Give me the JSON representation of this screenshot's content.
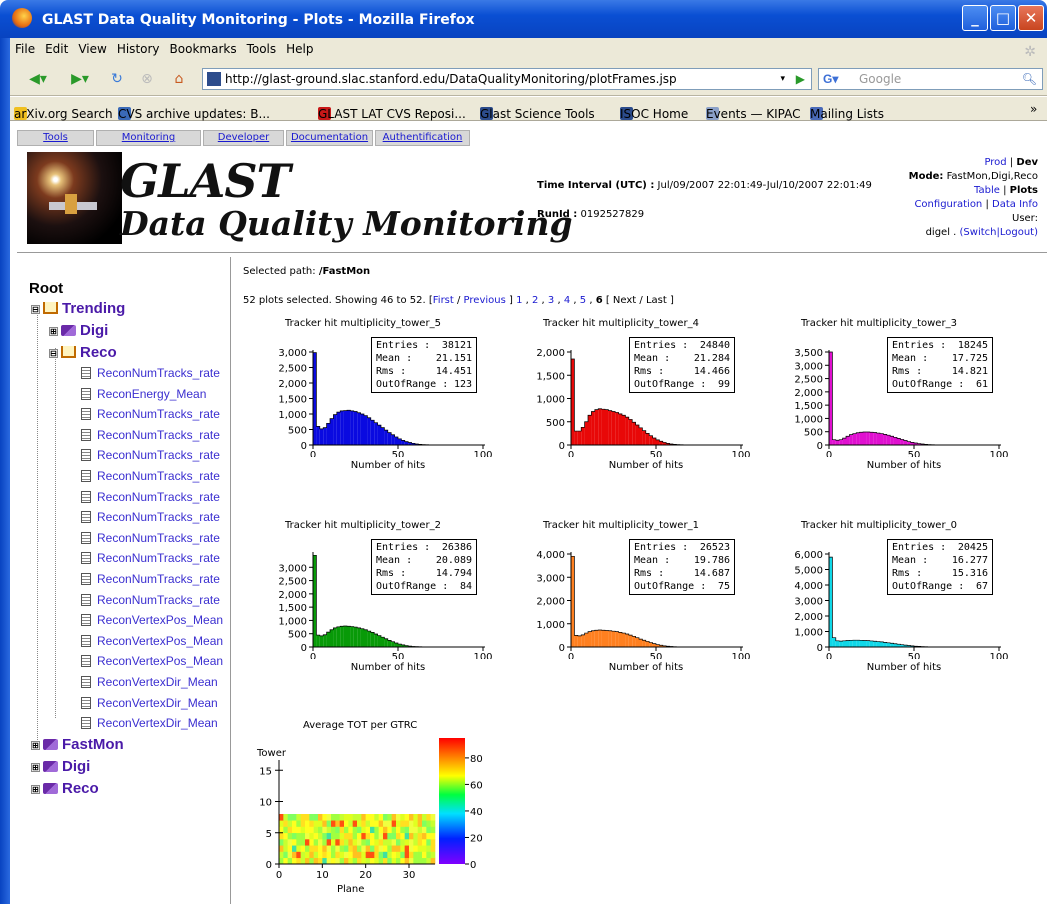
{
  "window": {
    "title": "GLAST Data Quality Monitoring - Plots - Mozilla Firefox"
  },
  "menu": [
    "File",
    "Edit",
    "View",
    "History",
    "Bookmarks",
    "Tools",
    "Help"
  ],
  "url": "http://glast-ground.slac.stanford.edu/DataQualityMonitoring/plotFrames.jsp",
  "search_placeholder": "Google",
  "bookmarks": [
    "arXiv.org Search",
    "CVS archive updates: B...",
    "GLAST LAT CVS Reposi...",
    "Glast Science Tools",
    "ISOC Home",
    "Events — KIPAC",
    "Mailing Lists"
  ],
  "bookmarks_overflow": "»",
  "topnav": [
    "Tools",
    "Monitoring",
    "Developer",
    "Documentation",
    "Authentification"
  ],
  "logo": {
    "line1": "GLAST",
    "line2": "Data Quality Monitoring"
  },
  "header": {
    "time_label": "Time Interval (UTC) :",
    "time_value": "Jul/09/2007 22:01:49-Jul/10/2007 22:01:49",
    "runid_label": "RunId :",
    "runid_value": "0192527829"
  },
  "right": {
    "prod": "Prod",
    "sep1": " | ",
    "dev": "Dev",
    "mode_label": "Mode:",
    "mode_value": "FastMon,Digi,Reco",
    "table": "Table",
    "sep2": " | ",
    "plots": "Plots",
    "configuration": "Configuration",
    "sep3": " | ",
    "datainfo": "Data Info",
    "user_label": "User:",
    "user_value": "digel .",
    "switch_logout": "(Switch|Logout)"
  },
  "tree": {
    "root": "Root",
    "trending": "Trending",
    "digi": "Digi",
    "reco": "Reco",
    "leaves": [
      "ReconNumTracks_rate",
      "ReconEnergy_Mean",
      "ReconNumTracks_rate",
      "ReconNumTracks_rate",
      "ReconNumTracks_rate",
      "ReconNumTracks_rate",
      "ReconNumTracks_rate",
      "ReconNumTracks_rate",
      "ReconNumTracks_rate",
      "ReconNumTracks_rate",
      "ReconNumTracks_rate",
      "ReconNumTracks_rate",
      "ReconVertexPos_Mean",
      "ReconVertexPos_Mean",
      "ReconVertexPos_Mean",
      "ReconVertexDir_Mean",
      "ReconVertexDir_Mean",
      "ReconVertexDir_Mean"
    ],
    "fastmon": "FastMon",
    "digi2": "Digi",
    "reco2": "Reco"
  },
  "content": {
    "selpath_label": "Selected path:",
    "selpath_value": "/FastMon",
    "plots_text": "52 plots selected. Showing 46 to 52. [",
    "first": "First",
    "slash1": " / ",
    "previous": "Previous",
    "pages": [
      "1",
      "2",
      "3",
      "4",
      "5"
    ],
    "current_page": "6",
    "next_last": "[ Next / Last ]"
  },
  "chart_data": [
    {
      "type": "bar",
      "title": "Tracker hit multiplicity_tower_5",
      "xlabel": "Number of hits",
      "xlim": [
        0,
        100
      ],
      "ylim": [
        0,
        3000
      ],
      "yticks": [
        "0",
        "500",
        "1,000",
        "1,500",
        "2,000",
        "2,500",
        "3,000"
      ],
      "xticks": [
        "0",
        "50",
        "100"
      ],
      "color": "#0a0ae0",
      "stats": {
        "entries": "38121",
        "mean": "21.151",
        "rms": "14.451",
        "outofrange": "123"
      },
      "values": [
        2980,
        600,
        520,
        560,
        700,
        850,
        980,
        1060,
        1100,
        1110,
        1120,
        1100,
        1080,
        1040,
        1000,
        950,
        880,
        800,
        720,
        640,
        560,
        480,
        400,
        330,
        260,
        200,
        150,
        110,
        80,
        55,
        35,
        22,
        14,
        8,
        5,
        3,
        2,
        1,
        1,
        0
      ]
    },
    {
      "type": "bar",
      "title": "Tracker hit multiplicity_tower_4",
      "xlabel": "Number of hits",
      "xlim": [
        0,
        100
      ],
      "ylim": [
        0,
        2000
      ],
      "yticks": [
        "0",
        "500",
        "1,000",
        "1,500",
        "2,000"
      ],
      "xticks": [
        "0",
        "50",
        "100"
      ],
      "color": "#e80808",
      "stats": {
        "entries": "24840",
        "mean": "21.284",
        "rms": "14.466",
        "outofrange": "99"
      },
      "values": [
        1850,
        300,
        300,
        380,
        500,
        640,
        720,
        760,
        780,
        770,
        760,
        740,
        720,
        700,
        670,
        640,
        600,
        550,
        490,
        430,
        370,
        310,
        250,
        200,
        150,
        110,
        80,
        55,
        35,
        22,
        14,
        8,
        5,
        3,
        2,
        1,
        1,
        0,
        0,
        0
      ]
    },
    {
      "type": "bar",
      "title": "Tracker hit multiplicity_tower_3",
      "xlabel": "Number of hits",
      "xlim": [
        0,
        100
      ],
      "ylim": [
        0,
        3500
      ],
      "yticks": [
        "0",
        "500",
        "1,000",
        "1,500",
        "2,000",
        "2,500",
        "3,000",
        "3,500"
      ],
      "xticks": [
        "0",
        "50",
        "100"
      ],
      "color": "#e010d0",
      "stats": {
        "entries": "18245",
        "mean": "17.725",
        "rms": "14.821",
        "outofrange": "61"
      },
      "values": [
        3500,
        200,
        180,
        200,
        260,
        330,
        390,
        430,
        460,
        480,
        490,
        490,
        480,
        470,
        450,
        430,
        400,
        370,
        330,
        290,
        250,
        210,
        170,
        130,
        100,
        75,
        55,
        38,
        25,
        16,
        10,
        6,
        4,
        2,
        1,
        1,
        0,
        0,
        0,
        0
      ]
    },
    {
      "type": "bar",
      "title": "Tracker hit multiplicity_tower_2",
      "xlabel": "Number of hits",
      "xlim": [
        0,
        100
      ],
      "ylim": [
        0,
        3500
      ],
      "yticks": [
        "0",
        "500",
        "1,000",
        "1,500",
        "2,000",
        "2,500",
        "3,000"
      ],
      "xticks": [
        "0",
        "50",
        "100"
      ],
      "color": "#089a08",
      "stats": {
        "entries": "26386",
        "mean": "20.089",
        "rms": "14.794",
        "outofrange": "84"
      },
      "values": [
        3450,
        450,
        420,
        460,
        560,
        650,
        720,
        760,
        780,
        790,
        780,
        770,
        750,
        720,
        690,
        650,
        600,
        550,
        490,
        430,
        370,
        310,
        250,
        200,
        150,
        110,
        80,
        55,
        35,
        22,
        14,
        8,
        5,
        3,
        2,
        1,
        1,
        0,
        0,
        0
      ]
    },
    {
      "type": "bar",
      "title": "Tracker hit multiplicity_tower_1",
      "xlabel": "Number of hits",
      "xlim": [
        0,
        100
      ],
      "ylim": [
        0,
        4000
      ],
      "yticks": [
        "0",
        "1,000",
        "2,000",
        "3,000",
        "4,000"
      ],
      "xticks": [
        "0",
        "50",
        "100"
      ],
      "color": "#ff8020",
      "stats": {
        "entries": "26523",
        "mean": "19.786",
        "rms": "14.687",
        "outofrange": "75"
      },
      "values": [
        3900,
        500,
        480,
        520,
        600,
        660,
        700,
        720,
        730,
        720,
        710,
        700,
        680,
        660,
        630,
        600,
        560,
        510,
        460,
        400,
        340,
        290,
        240,
        190,
        145,
        105,
        75,
        52,
        34,
        22,
        14,
        8,
        5,
        3,
        2,
        1,
        1,
        0,
        0,
        0
      ]
    },
    {
      "type": "bar",
      "title": "Tracker hit multiplicity_tower_0",
      "xlabel": "Number of hits",
      "xlim": [
        0,
        100
      ],
      "ylim": [
        0,
        6000
      ],
      "yticks": [
        "0",
        "1,000",
        "2,000",
        "3,000",
        "4,000",
        "5,000",
        "6,000"
      ],
      "xticks": [
        "0",
        "50",
        "100"
      ],
      "color": "#10d8e8",
      "stats": {
        "entries": "20425",
        "mean": "16.277",
        "rms": "15.316",
        "outofrange": "67"
      },
      "values": [
        5800,
        600,
        400,
        380,
        400,
        420,
        430,
        440,
        440,
        430,
        420,
        410,
        390,
        370,
        350,
        330,
        300,
        270,
        240,
        210,
        180,
        150,
        120,
        95,
        72,
        54,
        40,
        28,
        19,
        12,
        8,
        5,
        3,
        2,
        1,
        1,
        0,
        0,
        0,
        0
      ]
    },
    {
      "type": "heatmap",
      "title": "Average TOT per GTRC",
      "xlabel": "Plane",
      "ylabel": "Tower",
      "xlim": [
        0,
        36
      ],
      "ylim": [
        0,
        16
      ],
      "xticks": [
        "0",
        "10",
        "20",
        "30"
      ],
      "yticks": [
        "0",
        "5",
        "10",
        "15"
      ],
      "zticks": [
        "0",
        "20",
        "40",
        "60",
        "80"
      ],
      "zlim": [
        0,
        95
      ],
      "filled_rows": 8
    }
  ],
  "stat_labels": {
    "entries": "Entries :",
    "mean": "Mean :",
    "rms": "Rms :",
    "outofrange": "OutOfRange :"
  }
}
